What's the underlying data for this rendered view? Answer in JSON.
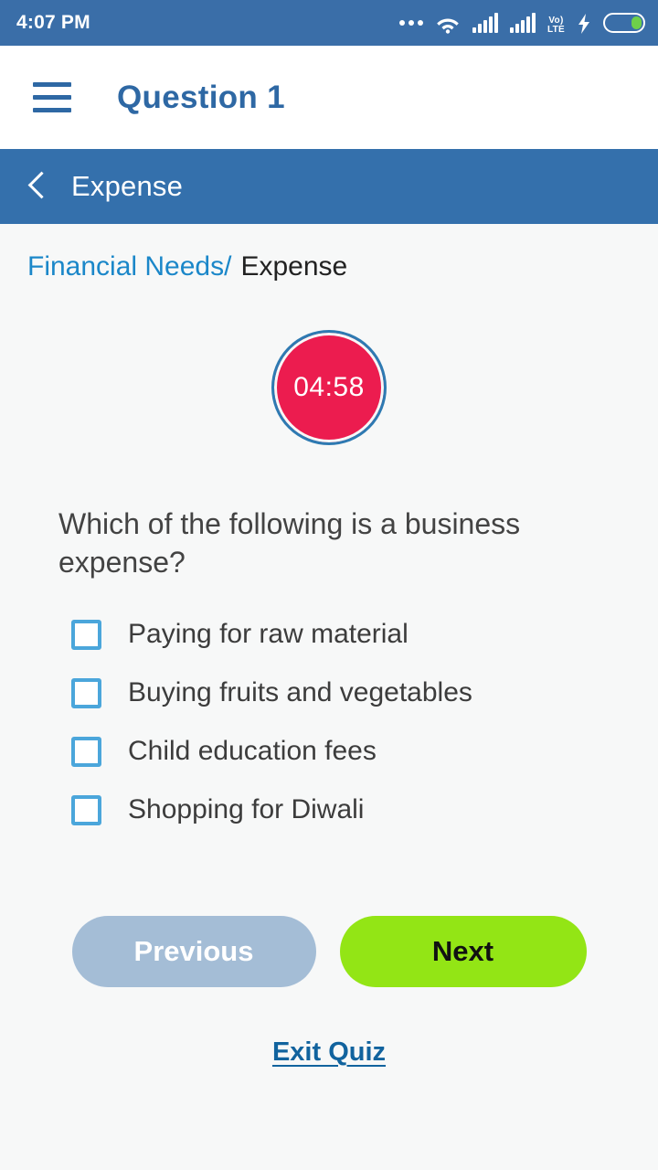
{
  "status_bar": {
    "time": "4:07 PM",
    "icons": [
      "more-dots-icon",
      "wifi-icon",
      "signal-icon-1",
      "signal-icon-2",
      "volte-icon",
      "charging-bolt-icon",
      "battery-icon"
    ],
    "volte_top": "Vo)",
    "volte_bottom": "LTE",
    "background": "#3a6ea8"
  },
  "app_bar": {
    "menu_icon": "hamburger-menu-icon",
    "title": "Question 1",
    "title_color": "#2e68a4"
  },
  "section_bar": {
    "back_icon": "back-chevron-icon",
    "title": "Expense",
    "background": "#3470ac"
  },
  "breadcrumb": {
    "parent": "Financial Needs",
    "separator": "/",
    "current": "Expense",
    "link_color": "#1b87c9"
  },
  "timer": {
    "value": "04:58",
    "fill_color": "#ec1c4f",
    "ring_color": "#2e7ab2"
  },
  "question": {
    "text": "Which of the following is a business expense?",
    "options": [
      {
        "label": "Paying for raw material",
        "checked": false
      },
      {
        "label": "Buying fruits and vegetables",
        "checked": false
      },
      {
        "label": "Child education fees",
        "checked": false
      },
      {
        "label": "Shopping for Diwali",
        "checked": false
      }
    ],
    "checkbox_color": "#4ba6db"
  },
  "navigation": {
    "previous_label": "Previous",
    "next_label": "Next",
    "previous_color": "#a4bdd6",
    "next_color": "#93e515",
    "exit_label": "Exit Quiz",
    "exit_color": "#11639e"
  }
}
